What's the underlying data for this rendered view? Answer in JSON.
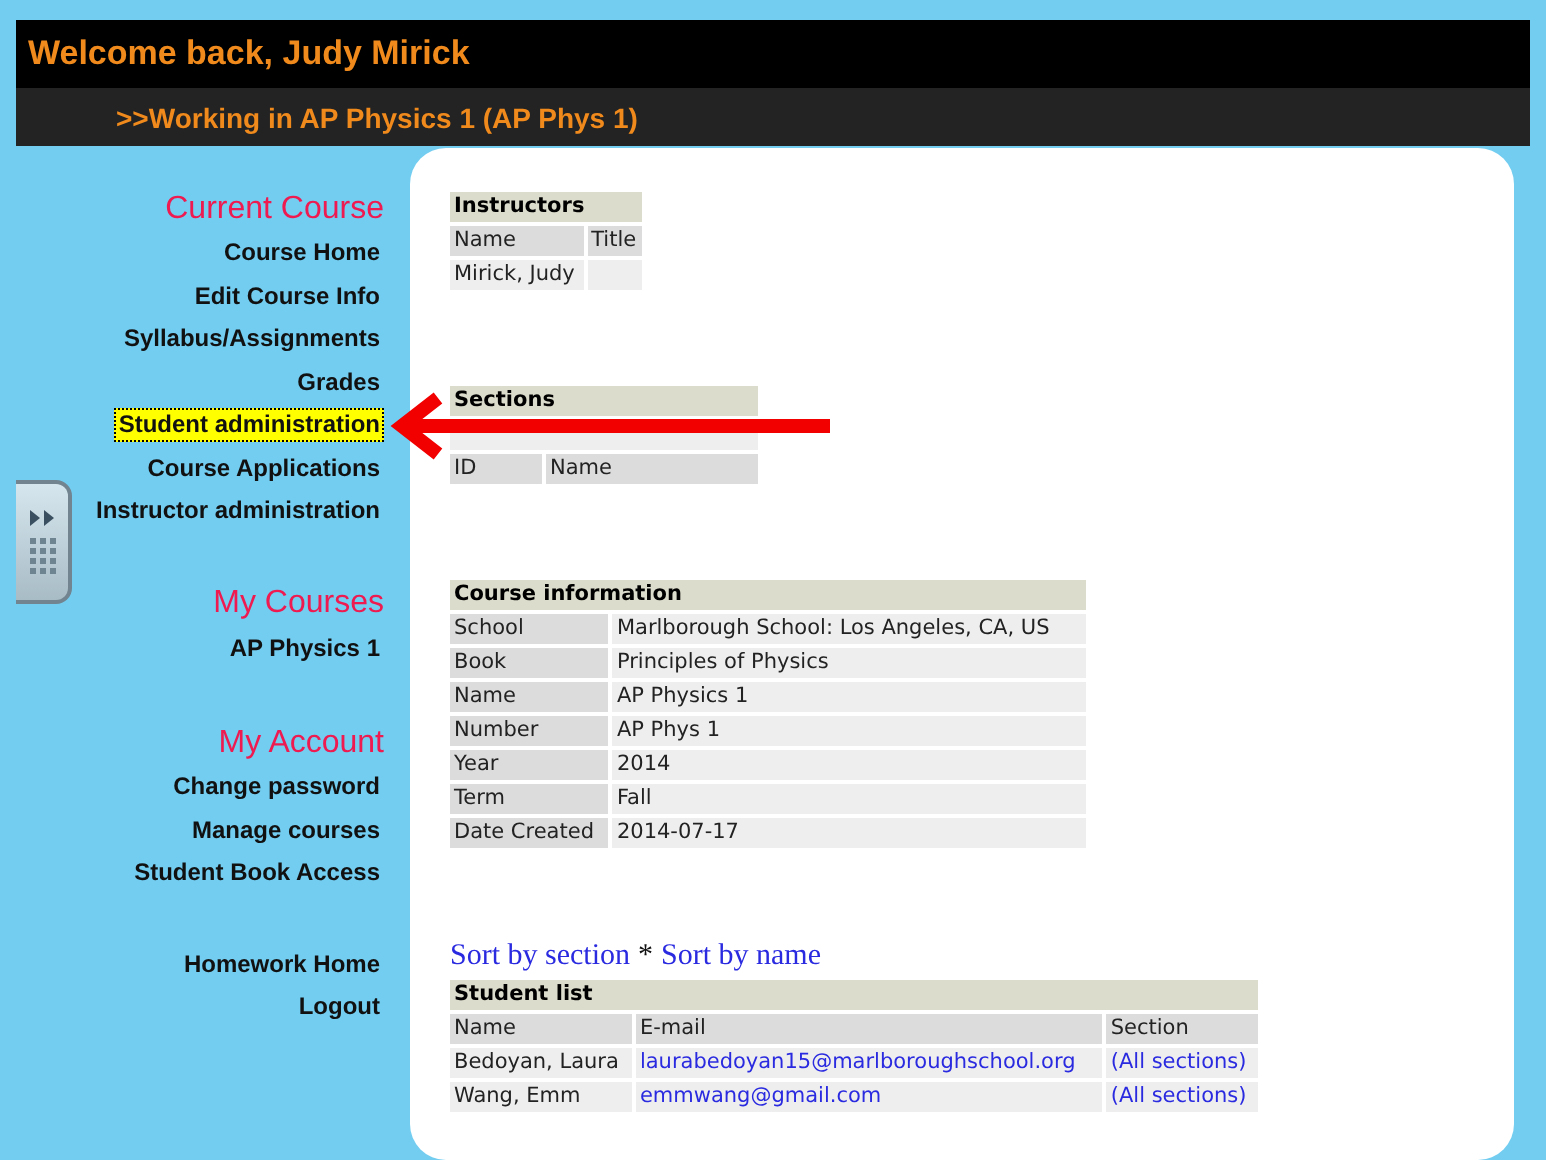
{
  "header": {
    "welcome": "Welcome back, Judy Mirick",
    "working": ">>Working in AP Physics 1 (AP Phys 1)"
  },
  "sidebar": {
    "groups": [
      {
        "heading": "Current Course",
        "items": [
          {
            "label": "Course Home",
            "selected": false
          },
          {
            "label": "Edit Course Info",
            "selected": false
          },
          {
            "label": "Syllabus/Assignments",
            "selected": false
          },
          {
            "label": "Grades",
            "selected": false
          },
          {
            "label": "Student administration",
            "selected": true
          },
          {
            "label": "Course Applications",
            "selected": false
          },
          {
            "label": "Instructor administration",
            "selected": false
          }
        ]
      },
      {
        "heading": "My Courses",
        "items": [
          {
            "label": "AP Physics 1",
            "selected": false
          }
        ]
      },
      {
        "heading": "My Account",
        "items": [
          {
            "label": "Change password",
            "selected": false
          },
          {
            "label": "Manage courses",
            "selected": false
          },
          {
            "label": "Student Book Access",
            "selected": false
          }
        ]
      },
      {
        "items": [
          {
            "label": "Homework Home",
            "selected": false
          },
          {
            "label": "Logout",
            "selected": false
          }
        ]
      }
    ]
  },
  "instructors": {
    "title": "Instructors",
    "columns": [
      "Name",
      "Title"
    ],
    "rows": [
      {
        "name": "Mirick, Judy"
      }
    ]
  },
  "sections": {
    "title": "Sections",
    "columns": [
      "ID",
      "Name"
    ]
  },
  "course_info": {
    "title": "Course information",
    "fields": [
      {
        "label": "School",
        "value": "Marlborough School: Los Angeles, CA, US"
      },
      {
        "label": "Book",
        "value": "Principles of Physics"
      },
      {
        "label": "Name",
        "value": "AP Physics 1"
      },
      {
        "label": "Number",
        "value": "AP Phys 1"
      },
      {
        "label": "Year",
        "value": "2014"
      },
      {
        "label": "Term",
        "value": "Fall"
      },
      {
        "label": "Date Created",
        "value": "2014-07-17"
      }
    ]
  },
  "sort_links": [
    "Sort by section",
    "Sort by name"
  ],
  "sort_separator": "*",
  "student_list": {
    "title": "Student list",
    "columns": [
      "Name",
      "E-mail",
      "Section"
    ],
    "rows": [
      {
        "name": "Bedoyan, Laura",
        "email": "laurabedoyan15@marlboroughschool.org",
        "section": "(All sections)"
      },
      {
        "name": "Wang, Emm",
        "email": "emmwang@gmail.com",
        "section": "(All sections)"
      }
    ]
  }
}
